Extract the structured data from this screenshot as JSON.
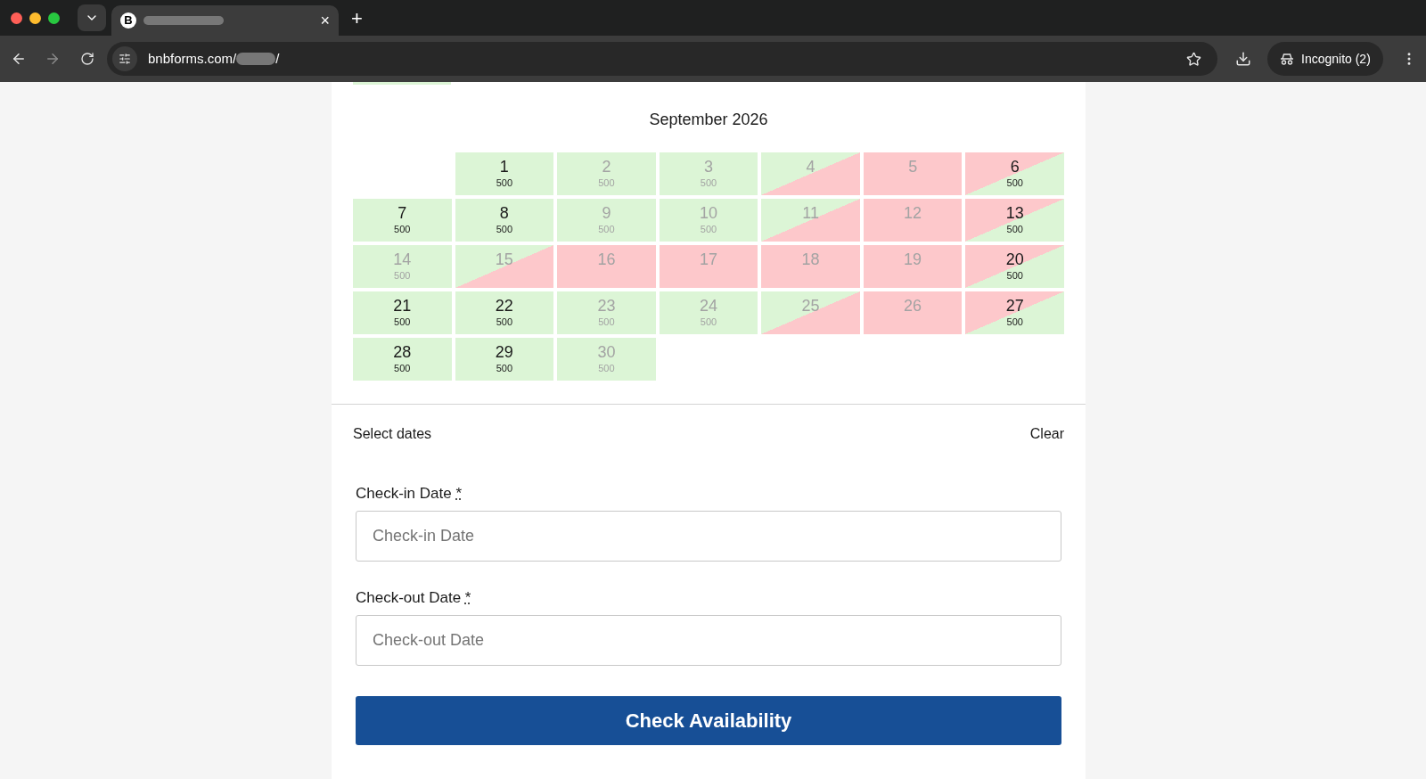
{
  "browser": {
    "tab": {
      "favicon": "B",
      "close": "×"
    },
    "new_tab": "+",
    "url_start": "bnbforms.com/",
    "url_end": "/",
    "profile": "Incognito (2)"
  },
  "calendar": {
    "month": "September 2026",
    "cells": [
      {
        "kind": "empty"
      },
      {
        "kind": "available",
        "day": "1",
        "price": "500",
        "disabled": false
      },
      {
        "kind": "available",
        "day": "2",
        "price": "500",
        "disabled": true
      },
      {
        "kind": "available",
        "day": "3",
        "price": "500",
        "disabled": true
      },
      {
        "kind": "checkin",
        "day": "4",
        "disabled": true
      },
      {
        "kind": "booked",
        "day": "5",
        "disabled": true
      },
      {
        "kind": "checkout",
        "day": "6",
        "price": "500",
        "disabled": false
      },
      {
        "kind": "available",
        "day": "7",
        "price": "500",
        "disabled": false
      },
      {
        "kind": "available",
        "day": "8",
        "price": "500",
        "disabled": false
      },
      {
        "kind": "available",
        "day": "9",
        "price": "500",
        "disabled": true
      },
      {
        "kind": "available",
        "day": "10",
        "price": "500",
        "disabled": true
      },
      {
        "kind": "checkin",
        "day": "11",
        "disabled": true
      },
      {
        "kind": "booked",
        "day": "12",
        "disabled": true
      },
      {
        "kind": "checkout",
        "day": "13",
        "price": "500",
        "disabled": false
      },
      {
        "kind": "available",
        "day": "14",
        "price": "500",
        "disabled": true
      },
      {
        "kind": "checkin",
        "day": "15",
        "disabled": true
      },
      {
        "kind": "booked",
        "day": "16",
        "disabled": true
      },
      {
        "kind": "booked",
        "day": "17",
        "disabled": true
      },
      {
        "kind": "booked",
        "day": "18",
        "disabled": true
      },
      {
        "kind": "booked",
        "day": "19",
        "disabled": true
      },
      {
        "kind": "checkout",
        "day": "20",
        "price": "500",
        "disabled": false
      },
      {
        "kind": "available",
        "day": "21",
        "price": "500",
        "disabled": false
      },
      {
        "kind": "available",
        "day": "22",
        "price": "500",
        "disabled": false
      },
      {
        "kind": "available",
        "day": "23",
        "price": "500",
        "disabled": true
      },
      {
        "kind": "available",
        "day": "24",
        "price": "500",
        "disabled": true
      },
      {
        "kind": "checkin",
        "day": "25",
        "disabled": true
      },
      {
        "kind": "booked",
        "day": "26",
        "disabled": true
      },
      {
        "kind": "checkout",
        "day": "27",
        "price": "500",
        "disabled": false
      },
      {
        "kind": "available",
        "day": "28",
        "price": "500",
        "disabled": false
      },
      {
        "kind": "available",
        "day": "29",
        "price": "500",
        "disabled": false
      },
      {
        "kind": "available",
        "day": "30",
        "price": "500",
        "disabled": true
      }
    ]
  },
  "selection": {
    "label": "Select dates",
    "clear": "Clear"
  },
  "fields": [
    {
      "label": "Check-in Date",
      "required": "*",
      "placeholder": "Check-in Date"
    },
    {
      "label": "Check-out Date",
      "required": "*",
      "placeholder": "Check-out Date"
    }
  ],
  "submit": "Check Availability"
}
